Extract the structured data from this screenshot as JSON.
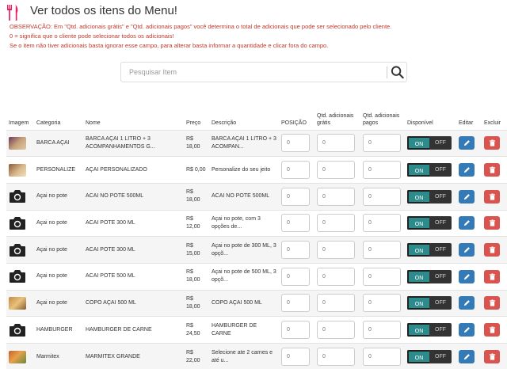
{
  "page": {
    "title": "Ver todos os itens do Menu!",
    "notes": [
      "OBSERVAÇÃO: Em \"Qtd. adicionais grátis\" e \"Qtd. adicionais pagos\" você determina o total de adicionais que pode ser selecionado pelo cliente.",
      "0 = significa que o cliente pode selecionar todos os adicionais!",
      "Se o item não tiver adicionais basta ignorar esse campo, para alterar basta informar a quantidade e clicar fora do campo."
    ]
  },
  "search": {
    "placeholder": "Pesquisar Item"
  },
  "table": {
    "headers": {
      "image": "Imagem",
      "category": "Categoria",
      "name": "Nome",
      "price": "Preço",
      "description": "Descrição",
      "position": "POSIÇÃO",
      "free_addons": "Qtd. adicionais grátis",
      "paid_addons": "Qtd. adicionais pagos",
      "available": "Disponível",
      "edit": "Editar",
      "delete": "Excluir"
    },
    "rows": [
      {
        "image": "photo",
        "category": "BARCA AÇAI",
        "name": "BARCA AÇAI 1 LITRO + 3 ACOMPANHAMENTOS G...",
        "price": "R$ 18,00",
        "description": "BARCA AÇAI 1 LITRO + 3 ACOMPAN...",
        "position": "0",
        "free": "0",
        "paid": "0"
      },
      {
        "image": "photo",
        "category": "PERSONALIZE",
        "name": "AÇAI PERSONALIZADO",
        "price": "R$ 0,00",
        "description": "Personalize do seu jeito",
        "position": "0",
        "free": "0",
        "paid": "0"
      },
      {
        "image": "camera",
        "category": "Açai no pote",
        "name": "ACAI NO POTE 500ML",
        "price": "R$ 18,00",
        "description": "ACAI NO POTE 500ML",
        "position": "0",
        "free": "0",
        "paid": "0"
      },
      {
        "image": "camera",
        "category": "Açai no pote",
        "name": "ACAI POTE 300 ML",
        "price": "R$ 12,00",
        "description": "Açai no pote, com 3 opções de...",
        "position": "0",
        "free": "0",
        "paid": "0"
      },
      {
        "image": "camera",
        "category": "Açai no pote",
        "name": "ACAI POTE 300 ML",
        "price": "R$ 15,00",
        "description": "Açai no pote de 300 ML, 3 opçõ...",
        "position": "0",
        "free": "0",
        "paid": "0"
      },
      {
        "image": "camera",
        "category": "Açai no pote",
        "name": "ACAI POTE 500 ML",
        "price": "R$ 18,00",
        "description": "Açai no pote de 500 ML, 3 opçõ...",
        "position": "0",
        "free": "0",
        "paid": "0"
      },
      {
        "image": "photo",
        "category": "Açai no pote",
        "name": "COPO AÇAI 500 ML",
        "price": "R$ 18,00",
        "description": "COPO AÇAI 500 ML",
        "position": "0",
        "free": "0",
        "paid": "0"
      },
      {
        "image": "camera",
        "category": "HAMBURGER",
        "name": "HAMBURGER DE CARNE",
        "price": "R$ 24,50",
        "description": "HAMBURGER DE CARNE",
        "position": "0",
        "free": "0",
        "paid": "0"
      },
      {
        "image": "photo",
        "category": "Marmitex",
        "name": "MARMITEX GRANDE",
        "price": "R$ 22,00",
        "description": "Selecione ate 2 carnes e até u...",
        "position": "0",
        "free": "0",
        "paid": "0"
      }
    ],
    "toggle": {
      "on": "ON",
      "off": "OFF"
    }
  },
  "colors": {
    "accent_pink": "#e91e63",
    "notes_red": "#c0392b",
    "toggle_teal": "#2e8b8b",
    "edit_blue": "#337ab7",
    "delete_red": "#d9534f"
  },
  "icons": {
    "header": "cutlery-icon",
    "search": "search-icon",
    "camera": "camera-icon",
    "edit": "pencil-icon",
    "delete": "trash-icon"
  }
}
